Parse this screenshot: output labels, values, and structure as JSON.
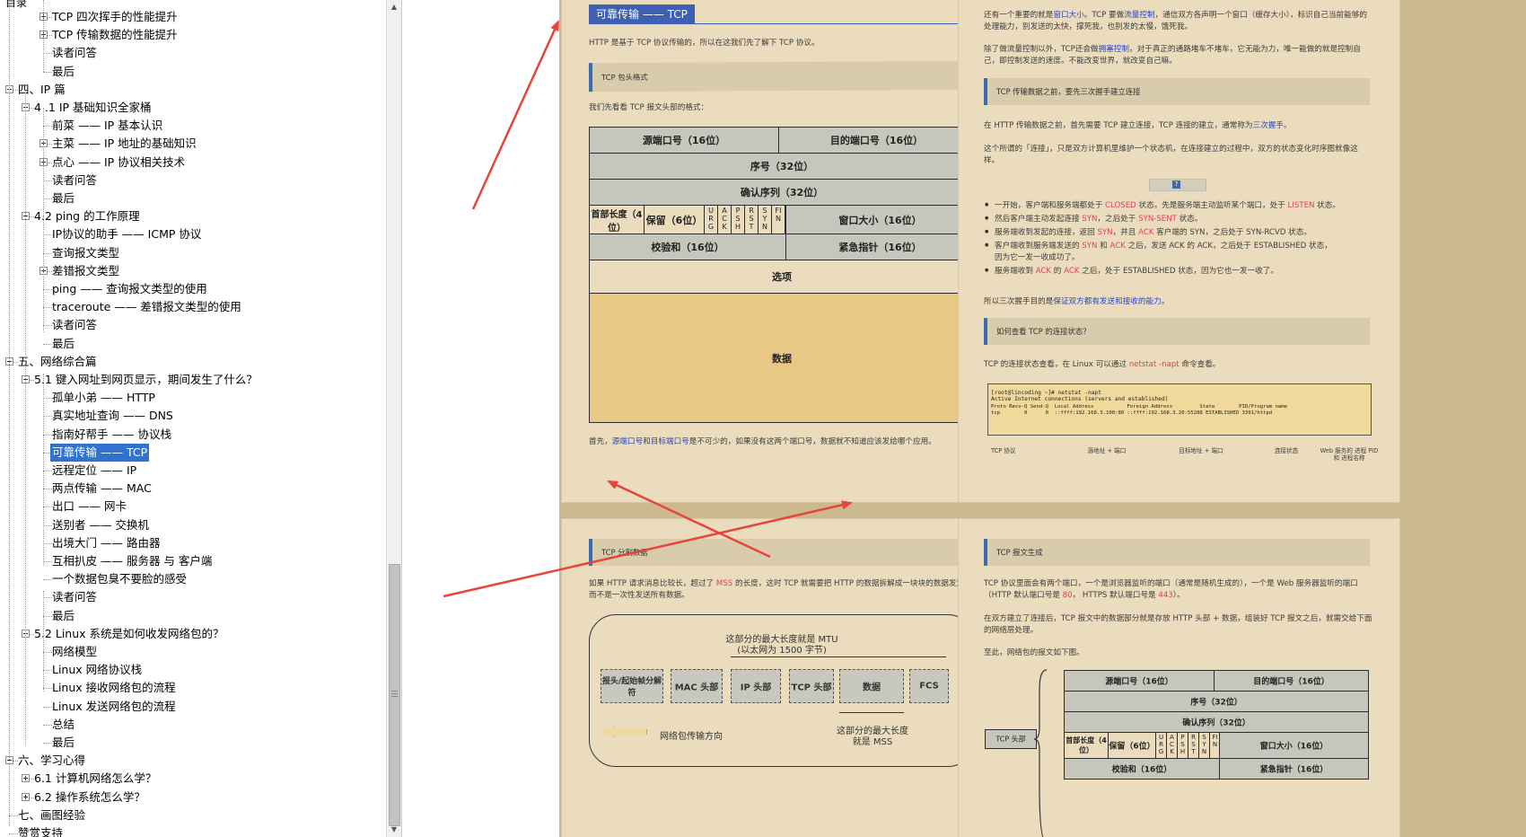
{
  "outline": {
    "top_partial": "目录",
    "items": [
      {
        "label": "TCP 四次挥手的性能提升",
        "level": 2,
        "toggle": "plus"
      },
      {
        "label": "TCP 传输数据的性能提升",
        "level": 2,
        "toggle": "plus"
      },
      {
        "label": "读者问答",
        "level": 2
      },
      {
        "label": "最后",
        "level": 2
      },
      {
        "label": "四、IP 篇",
        "level": 0,
        "toggle": "minus"
      },
      {
        "label": "4 .1 IP 基础知识全家桶",
        "level": 1,
        "toggle": "minus"
      },
      {
        "label": "前菜 —— IP 基本认识",
        "level": 2
      },
      {
        "label": "主菜 —— IP 地址的基础知识",
        "level": 2,
        "toggle": "plus"
      },
      {
        "label": "点心 —— IP 协议相关技术",
        "level": 2,
        "toggle": "plus"
      },
      {
        "label": "读者问答",
        "level": 2
      },
      {
        "label": "最后",
        "level": 2
      },
      {
        "label": "4.2 ping 的工作原理",
        "level": 1,
        "toggle": "minus"
      },
      {
        "label": "IP协议的助手 —— ICMP 协议",
        "level": 2
      },
      {
        "label": "查询报文类型",
        "level": 2
      },
      {
        "label": "差错报文类型",
        "level": 2,
        "toggle": "plus"
      },
      {
        "label": "ping —— 查询报文类型的使用",
        "level": 2
      },
      {
        "label": "traceroute —— 差错报文类型的使用",
        "level": 2
      },
      {
        "label": "读者问答",
        "level": 2
      },
      {
        "label": "最后",
        "level": 2
      },
      {
        "label": "五、网络综合篇",
        "level": 0,
        "toggle": "minus"
      },
      {
        "label": "5.1 键入网址到网页显示，期间发生了什么？",
        "level": 1,
        "toggle": "minus"
      },
      {
        "label": "孤单小弟 —— HTTP",
        "level": 2
      },
      {
        "label": "真实地址查询 —— DNS",
        "level": 2
      },
      {
        "label": "指南好帮手 —— 协议栈",
        "level": 2
      },
      {
        "label": "可靠传输 —— TCP",
        "level": 2,
        "selected": true
      },
      {
        "label": "远程定位 —— IP",
        "level": 2
      },
      {
        "label": "两点传输 —— MAC",
        "level": 2
      },
      {
        "label": "出口 —— 网卡",
        "level": 2
      },
      {
        "label": "送别者 —— 交换机",
        "level": 2
      },
      {
        "label": "出境大门 —— 路由器",
        "level": 2
      },
      {
        "label": "互相扒皮 —— 服务器 与 客户端",
        "level": 2
      },
      {
        "label": "一个数据包臭不要脸的感受",
        "level": 2
      },
      {
        "label": "读者问答",
        "level": 2
      },
      {
        "label": "最后",
        "level": 2
      },
      {
        "label": "5.2 Linux 系统是如何收发网络包的？",
        "level": 1,
        "toggle": "minus"
      },
      {
        "label": "网络模型",
        "level": 2
      },
      {
        "label": "Linux 网络协议栈",
        "level": 2
      },
      {
        "label": "Linux 接收网络包的流程",
        "level": 2
      },
      {
        "label": "Linux 发送网络包的流程",
        "level": 2
      },
      {
        "label": "总结",
        "level": 2
      },
      {
        "label": "最后",
        "level": 2
      },
      {
        "label": "六、学习心得",
        "level": 0,
        "toggle": "minus"
      },
      {
        "label": "6.1 计算机网络怎么学？",
        "level": 1,
        "toggle": "plus"
      },
      {
        "label": "6.2 操作系统怎么学？",
        "level": 1,
        "toggle": "plus"
      },
      {
        "label": "七、画图经验",
        "level": 0
      },
      {
        "label": "赞赏支持",
        "level": 0
      }
    ]
  },
  "page1": {
    "section_title": "可靠传输 —— TCP",
    "intro": "HTTP 是基于 TCP 协议传输的，所以在这我们先了解下 TCP 协议。",
    "box1": "TCP 包头格式",
    "lead": "我们先看看 TCP 报文头部的格式：",
    "diagram": {
      "src_port": "源端口号（16位）",
      "dst_port": "目的端口号（16位）",
      "seq": "序号（32位）",
      "ack": "确认序列（32位）",
      "hdr_len": "首部长度（4位）",
      "reserved": "保留（6位）",
      "flags": [
        "URG",
        "ACK",
        "PSH",
        "RST",
        "SYN",
        "FIN"
      ],
      "window": "窗口大小（16位）",
      "checksum": "校验和（16位）",
      "urgent": "紧急指针（16位）",
      "options": "选项",
      "data": "数据"
    },
    "after_a": "首先，",
    "after_src": "源端口号",
    "after_and": "和",
    "after_dst": "目标端口号",
    "after_b": "是不可少的，如果没有这两个端口号，数据就不知道应该发给哪个应用。"
  },
  "page2": {
    "para1_a": "还有一个重要的就是",
    "para1_win": "窗口大小",
    "para1_b": "。TCP 要做",
    "para1_flow": "流量控制",
    "para1_c": "，通信双方各声明一个窗口（缓存大小），标识自己当前能够的",
    "para1_d": "处理能力，别发送的太快，撑死我，也别发的太慢，饿死我。",
    "para2_a": "除了做流量控制以外，TCP还会做",
    "para2_cong": "拥塞控制",
    "para2_b": "，对于真正的通路堵车不堵车，它无能为力，唯一能做的就是控制自",
    "para2_c": "己，即控制发送的速度。不能改变世界，就改变自己嘛。",
    "box2": "TCP 传输数据之前，要先三次握手建立连接",
    "para3_a": "在 HTTP 传输数据之前，首先需要 TCP 建立连接，TCP 连接的建立，通常称为",
    "para3_hs": "三次握手",
    "para3_b": "。",
    "para4_a": "这个所谓的「连接」，只是双方计算机里维护一个状态机，在连接建立的过程中，双方的状态变化时序图就像这",
    "para4_b": "样。",
    "bullets": [
      {
        "pre": "一开始，客户端和服务端都处于 ",
        "r1": "CLOSED",
        "mid": " 状态。先是服务端主动监听某个端口，处于 ",
        "r2": "LISTEN",
        "post": " 状态。"
      },
      {
        "pre": "然后客户端主动发起连接 ",
        "r1": "SYN",
        "mid": "，之后处于 ",
        "r2": "SYN-SENT",
        "post": " 状态。"
      },
      {
        "pre": "服务端收到发起的连接，返回 ",
        "r1": "SYN",
        "mid": "，并且 ",
        "r2": "ACK",
        "post": " 客户端的 SYN，之后处于 SYN-RCVD 状态。"
      },
      {
        "pre": "客户端收到服务端发送的 ",
        "r1": "SYN",
        "mid": " 和 ",
        "r2": "ACK",
        "post": " 之后，发送 ACK 的 ACK，之后处于 ESTABLISHED 状态，"
      },
      {
        "pre": "因为它一发一收成功了。",
        "r1": "",
        "mid": "",
        "r2": "",
        "post": ""
      },
      {
        "pre": "服务端收到 ",
        "r1": "ACK",
        "mid": " 的 ",
        "r2": "ACK",
        "post": " 之后，处于 ESTABLISHED 状态，因为它也一发一收了。"
      }
    ],
    "para5_a": "所以三次握手目的是",
    "para5_b": "保证双方都有发送和接收的能力",
    "para5_c": "。",
    "box3": "如何查看 TCP 的连接状态？",
    "para6_a": "TCP 的连接状态查看，在 Linux 可以通过 ",
    "para6_cmd": "netstat -napt",
    "para6_b": " 命令查看。",
    "terminal": [
      "[root@lincoding ~]# netstat -napt",
      "Active Internet connections (servers and established)",
      "Proto Recv-Q Send-Q  Local Address           Foreign Address         State        PID/Program name",
      "tcp        0      0  ::ffff:192.168.3.100:80 ::ffff:192.168.3.20:55288 ESTABLISHED 3391/httpd"
    ],
    "term_labels": [
      "TCP 协议",
      "源地址 + 端口",
      "目标地址 + 端口",
      "连接状态",
      "Web 服务的 进程 PID 和 进程名称"
    ]
  },
  "page3": {
    "box": "TCP 分割数据",
    "para_a": "如果 HTTP 请求消息比较长，超过了 ",
    "para_mss": "MSS",
    "para_b": " 的长度，这时 TCP 就需要把 HTTP 的数据拆解成一块块的数据发送，",
    "para_c": "而不是一次性发送所有数据。",
    "mtu_text1": "这部分的最大长度就是 MTU",
    "mtu_text2": "(以太网为 1500 字节)",
    "segments": [
      "报头/起始帧分解符",
      "MAC 头部",
      "IP 头部",
      "TCP 头部",
      "数据",
      "FCS"
    ],
    "mss_text1": "这部分的最大长度",
    "mss_text2": "就是 MSS",
    "dir_text": "网络包传输方向"
  },
  "page4": {
    "box": "TCP 报文生成",
    "para1_a": "TCP 协议里面会有两个端口，一个是浏览器监听的端口（通常是随机生成的），一个是 Web 服务器监听的端口",
    "para1_b": "（HTTP 默认端口号是 ",
    "para1_80": "80",
    "para1_c": "， HTTPS 默认端口号是 ",
    "para1_443": "443",
    "para1_d": "）。",
    "para2_a": "在双方建立了连接后，TCP 报文中的数据部分就是存放 HTTP 头部 + 数据，组装好 TCP 报文之后，就需交给下面",
    "para2_b": "的网络层处理。",
    "para3": "至此，网络包的报文如下图。",
    "tcp_label": "TCP 头部"
  },
  "colors": {
    "accent": "#3f5fb2",
    "link": "#2a44c8",
    "highlight_red": "#e23d5e",
    "page_bg": "#eadcbd",
    "selection": "#3072d0",
    "annotation_arrow": "#e8443a"
  }
}
